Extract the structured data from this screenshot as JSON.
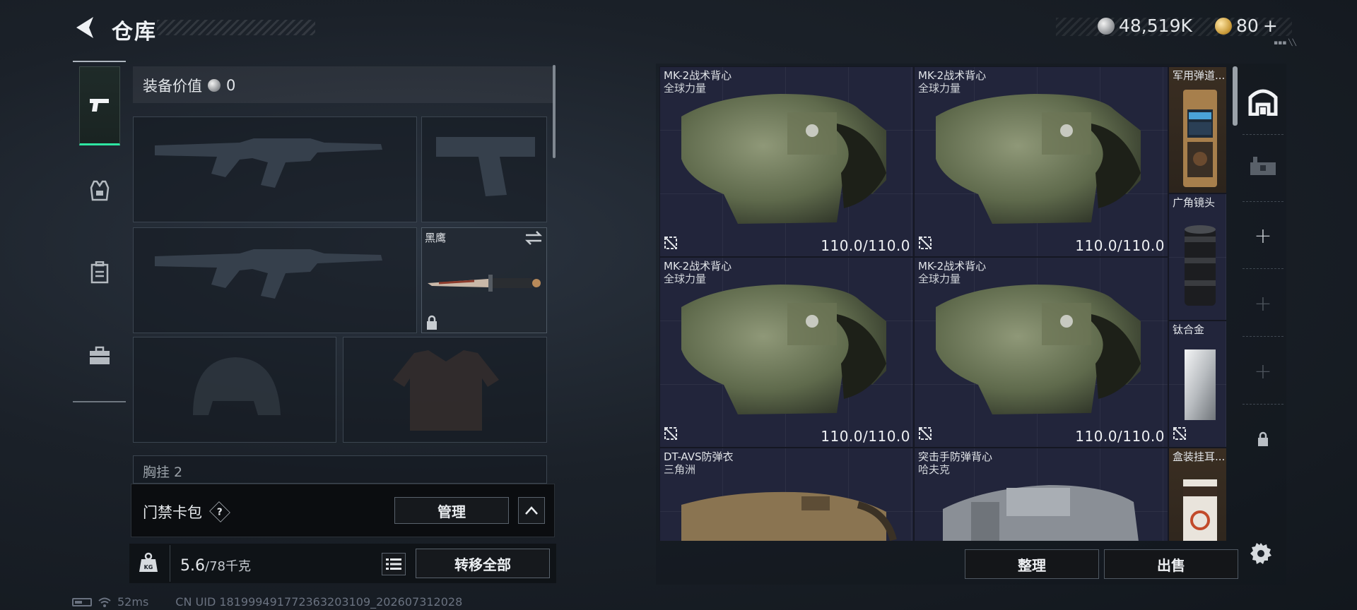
{
  "header": {
    "title": "仓库",
    "currency_coin": "48,519K",
    "currency_bond": "80",
    "currency_bond_add": "+",
    "sys_tag": "▪▪▪ ╲╲"
  },
  "loadout": {
    "equip_value_label": "装备价值",
    "equip_value": "0",
    "melee_name": "黑鹰",
    "chest_label": "胸挂 2"
  },
  "card_bag": {
    "label": "门禁卡包",
    "help": "?",
    "manage_label": "管理"
  },
  "footer_left": {
    "weight_current": "5.6",
    "weight_max": "/78千克",
    "transfer_all_label": "转移全部"
  },
  "stash": {
    "items": [
      {
        "name": "MK-2战术背心",
        "sub": "全球力量",
        "durability": "110.0/110.0"
      },
      {
        "name": "MK-2战术背心",
        "sub": "全球力量",
        "durability": "110.0/110.0"
      },
      {
        "name": "MK-2战术背心",
        "sub": "全球力量",
        "durability": "110.0/110.0"
      },
      {
        "name": "MK-2战术背心",
        "sub": "全球力量",
        "durability": "110.0/110.0"
      },
      {
        "name": "DT-AVS防弹衣",
        "sub": "三角洲"
      },
      {
        "name": "突击手防弹背心",
        "sub": "哈夫克"
      }
    ],
    "small_items": [
      {
        "name": "军用弹道..."
      },
      {
        "name": "广角镜头"
      },
      {
        "name": "钛合金"
      },
      {
        "name": "盒装挂耳..."
      }
    ]
  },
  "actions": {
    "sort_label": "整理",
    "sell_label": "出售"
  },
  "status_bar": {
    "ping": "52ms",
    "uid": "CN UID 181999491772363203109_202607312028"
  },
  "colors": {
    "accent_green": "#2ee6a2",
    "grid_bg": "#22253b",
    "gold_cell": "#3a2e22"
  }
}
